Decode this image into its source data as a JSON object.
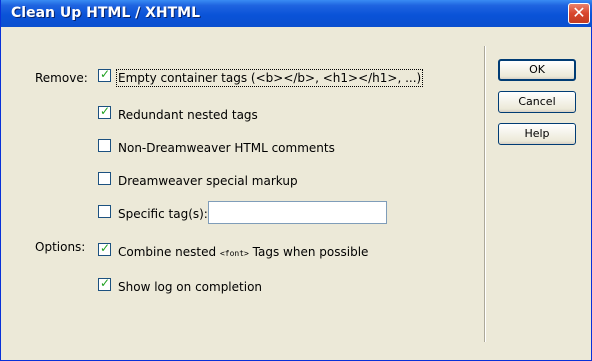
{
  "title": "Clean Up HTML / XHTML",
  "close_glyph": "✕",
  "remove_label": "Remove:",
  "options_label": "Options:",
  "remove_items": {
    "empty_container": {
      "label": "Empty container tags (<b></b>, <h1></h1>, ...)",
      "checked": true
    },
    "redundant_nested": {
      "label": "Redundant nested tags",
      "checked": true
    },
    "non_dw_comments": {
      "label": "Non-Dreamweaver HTML comments",
      "checked": false
    },
    "dw_special_markup": {
      "label": "Dreamweaver special markup",
      "checked": false
    },
    "specific_tags": {
      "label": "Specific tag(s):",
      "checked": false,
      "value": ""
    }
  },
  "option_items": {
    "combine_font": {
      "prefix": "Combine nested",
      "tag": "<font>",
      "suffix": "Tags when possible",
      "checked": true
    },
    "show_log": {
      "label": "Show log on completion",
      "checked": true
    }
  },
  "buttons": {
    "ok": "OK",
    "cancel": "Cancel",
    "help": "Help"
  },
  "icons": {
    "checkbox": "checkbox-icon",
    "close": "close-icon"
  }
}
